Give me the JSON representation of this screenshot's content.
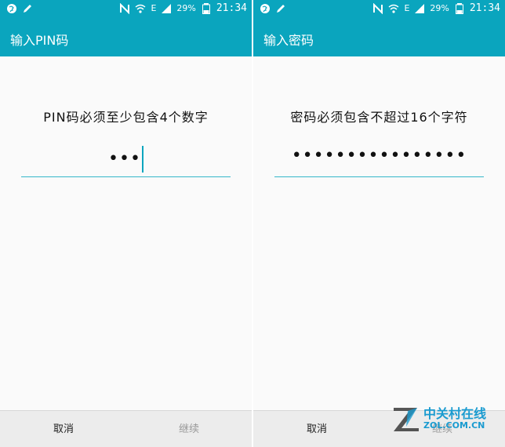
{
  "status": {
    "battery": "29%",
    "time": "21:34",
    "network": "E"
  },
  "left": {
    "title": "输入PIN码",
    "prompt": "PIN码必须至少包含4个数字",
    "value": "•••",
    "cancel": "取消",
    "continue": "继续"
  },
  "right": {
    "title": "输入密码",
    "prompt": "密码必须包含不超过16个字符",
    "value": "••••••••••••••••",
    "cancel": "取消",
    "continue": "继续"
  },
  "watermark": {
    "line1": "中关村在线",
    "line2": "ZOL.COM.CN"
  },
  "colors": {
    "accent": "#0aa5be",
    "underline": "#37b7c9",
    "bottombar": "#ececec"
  }
}
